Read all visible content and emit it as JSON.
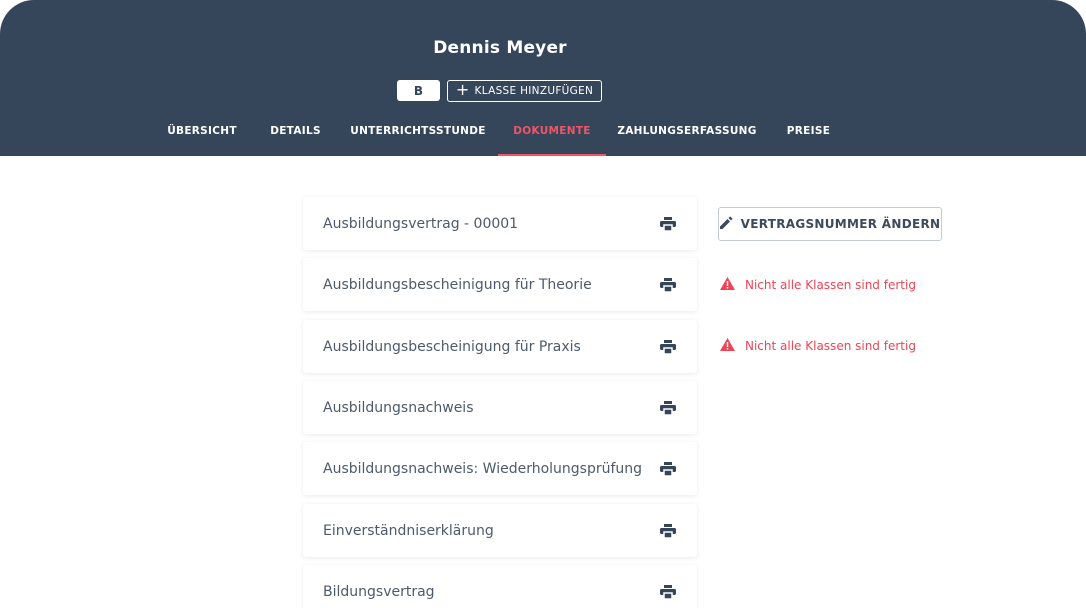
{
  "header": {
    "student_name": "Dennis Meyer",
    "class_badge": "B",
    "add_class_label": "KLASSE HINZUFÜGEN"
  },
  "tabs": [
    {
      "label": "ÜBERSICHT",
      "active": false
    },
    {
      "label": "DETAILS",
      "active": false
    },
    {
      "label": "UNTERRICHTSSTUNDE",
      "active": false
    },
    {
      "label": "DOKUMENTE",
      "active": true
    },
    {
      "label": "ZAHLUNGSERFASSUNG",
      "active": false
    },
    {
      "label": "PREISE",
      "active": false
    }
  ],
  "documents": [
    {
      "title": "Ausbildungsvertrag - 00001",
      "icon": "print-icon"
    },
    {
      "title": "Ausbildungsbescheinigung für Theorie",
      "icon": "print-icon"
    },
    {
      "title": "Ausbildungsbescheinigung für Praxis",
      "icon": "print-icon"
    },
    {
      "title": "Ausbildungsnachweis",
      "icon": "print-icon"
    },
    {
      "title": "Ausbildungsnachweis: Wiederholungsprüfung",
      "icon": "print-icon"
    },
    {
      "title": "Einverständniserklärung",
      "icon": "print-icon"
    },
    {
      "title": "Bildungsvertrag",
      "icon": "print-icon"
    }
  ],
  "side": {
    "edit_contract_label": "VERTRAGSNUMMER ÄNDERN",
    "warnings": [
      "Nicht alle Klassen sind fertig",
      "Nicht alle Klassen sind fertig"
    ]
  },
  "colors": {
    "header_bg": "#36465a",
    "accent": "#ef5566",
    "warning": "#ef4455"
  }
}
